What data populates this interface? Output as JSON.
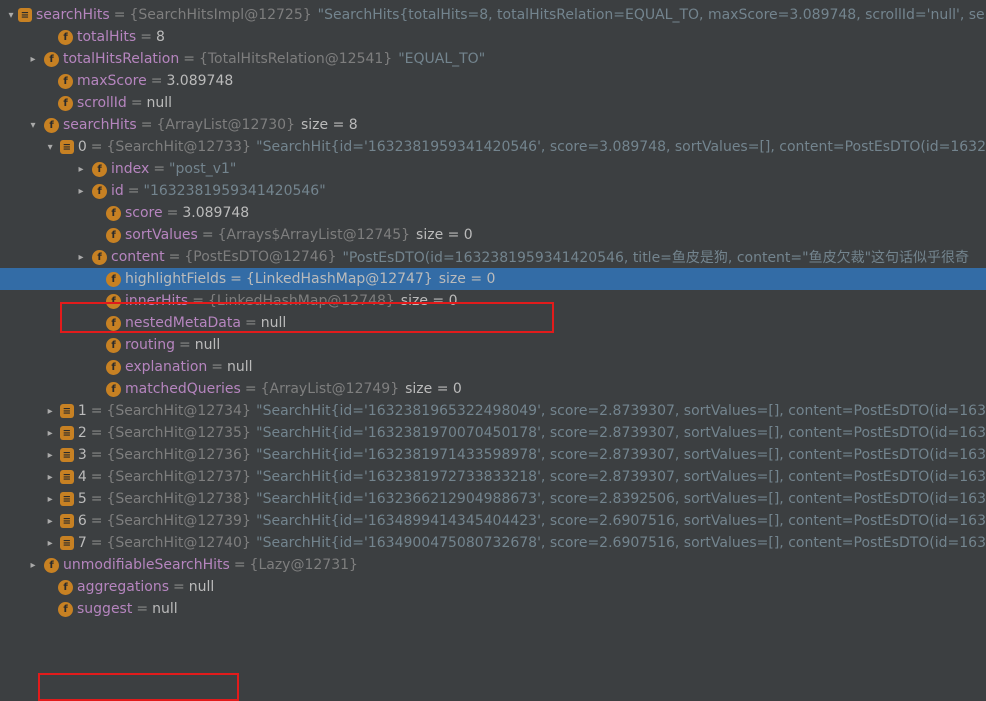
{
  "root": {
    "name": "searchHits",
    "obj": "{SearchHitsImpl@12725}",
    "preview": "\"SearchHits{totalHits=8, totalHitsRelation=EQUAL_TO, maxScore=3.089748, scrollId='null', se"
  },
  "totalHits": {
    "name": "totalHits",
    "value": "8"
  },
  "totalHitsRelation": {
    "name": "totalHitsRelation",
    "obj": "{TotalHitsRelation@12541}",
    "value": "\"EQUAL_TO\""
  },
  "maxScore": {
    "name": "maxScore",
    "value": "3.089748"
  },
  "scrollId": {
    "name": "scrollId",
    "value": "null"
  },
  "searchHitsList": {
    "name": "searchHits",
    "obj": "{ArrayList@12730}",
    "size": "size = 8"
  },
  "hit0": {
    "idx": "0",
    "obj": "{SearchHit@12733}",
    "preview": "\"SearchHit{id='1632381959341420546', score=3.089748, sortValues=[], content=PostEsDTO(id=1632",
    "index": {
      "name": "index",
      "value": "\"post_v1\""
    },
    "id": {
      "name": "id",
      "value": "\"1632381959341420546\""
    },
    "score": {
      "name": "score",
      "value": "3.089748"
    },
    "sortValues": {
      "name": "sortValues",
      "obj": "{Arrays$ArrayList@12745}",
      "size": "size = 0"
    },
    "content": {
      "name": "content",
      "obj": "{PostEsDTO@12746}",
      "preview": "\"PostEsDTO(id=1632381959341420546, title=鱼皮是狗, content=\"鱼皮欠裁\"这句话似乎很奇"
    },
    "highlightFields": {
      "name": "highlightFields",
      "obj": "{LinkedHashMap@12747}",
      "size": "size = 0"
    },
    "innerHits": {
      "name": "innerHits",
      "obj": "{LinkedHashMap@12748}",
      "size": "size = 0"
    },
    "nestedMetaData": {
      "name": "nestedMetaData",
      "value": "null"
    },
    "routing": {
      "name": "routing",
      "value": "null"
    },
    "explanation": {
      "name": "explanation",
      "value": "null"
    },
    "matchedQueries": {
      "name": "matchedQueries",
      "obj": "{ArrayList@12749}",
      "size": "size = 0"
    }
  },
  "hits": [
    {
      "idx": "1",
      "obj": "{SearchHit@12734}",
      "preview": "\"SearchHit{id='1632381965322498049', score=2.8739307, sortValues=[], content=PostEsDTO(id=163"
    },
    {
      "idx": "2",
      "obj": "{SearchHit@12735}",
      "preview": "\"SearchHit{id='1632381970070450178', score=2.8739307, sortValues=[], content=PostEsDTO(id=163"
    },
    {
      "idx": "3",
      "obj": "{SearchHit@12736}",
      "preview": "\"SearchHit{id='1632381971433598978', score=2.8739307, sortValues=[], content=PostEsDTO(id=163"
    },
    {
      "idx": "4",
      "obj": "{SearchHit@12737}",
      "preview": "\"SearchHit{id='1632381972733833218', score=2.8739307, sortValues=[], content=PostEsDTO(id=163"
    },
    {
      "idx": "5",
      "obj": "{SearchHit@12738}",
      "preview": "\"SearchHit{id='1632366212904988673', score=2.8392506, sortValues=[], content=PostEsDTO(id=163"
    },
    {
      "idx": "6",
      "obj": "{SearchHit@12739}",
      "preview": "\"SearchHit{id='1634899414345404423', score=2.6907516, sortValues=[], content=PostEsDTO(id=163"
    },
    {
      "idx": "7",
      "obj": "{SearchHit@12740}",
      "preview": "\"SearchHit{id='1634900475080732678', score=2.6907516, sortValues=[], content=PostEsDTO(id=163"
    }
  ],
  "unmodifiableSearchHits": {
    "name": "unmodifiableSearchHits",
    "obj": "{Lazy@12731}"
  },
  "aggregations": {
    "name": "aggregations",
    "value": "null"
  },
  "suggest": {
    "name": "suggest",
    "value": "null"
  }
}
